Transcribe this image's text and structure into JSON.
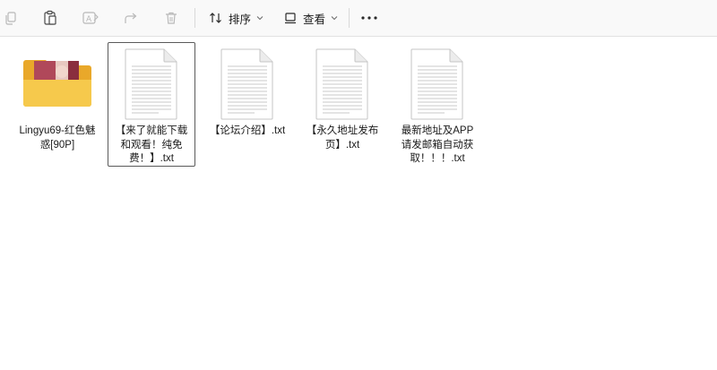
{
  "toolbar": {
    "copy_icon": "copy-icon",
    "paste_icon": "paste-icon",
    "rename_icon": "rename-icon",
    "share_icon": "share-icon",
    "delete_icon": "delete-icon",
    "sort_label": "排序",
    "view_label": "查看",
    "more_icon": "more-icon"
  },
  "files": [
    {
      "name": "Lingyu69-红色魅惑[90P]",
      "kind": "folder",
      "selected": false
    },
    {
      "name": "【来了就能下载和观看！纯免费！】.txt",
      "kind": "txt",
      "selected": true
    },
    {
      "name": "【论坛介绍】.txt",
      "kind": "txt",
      "selected": false
    },
    {
      "name": "【永久地址发布页】.txt",
      "kind": "txt",
      "selected": false
    },
    {
      "name": "最新地址及APP请发邮箱自动获取！！！.txt",
      "kind": "txt",
      "selected": false
    }
  ],
  "colors": {
    "folder_back": "#e9a82a",
    "folder_front": "#f6c94c",
    "selection_border": "#5a5a5a",
    "toolbar_bg": "#f9f9f9"
  }
}
